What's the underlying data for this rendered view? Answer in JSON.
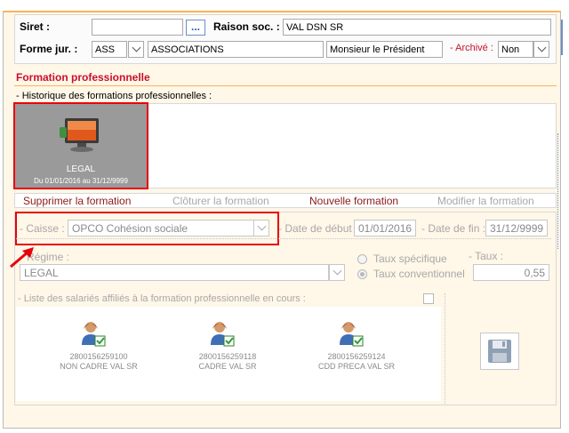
{
  "header": {
    "siret_label": "Siret :",
    "siret_value": "",
    "ellipsis_label": "...",
    "raison_label": "Raison soc. :",
    "raison_value": "VAL DSN SR",
    "forme_label": "Forme jur. :",
    "forme_code": "ASS",
    "forme_value": "ASSOCIATIONS",
    "title_value": "Monsieur le Président",
    "archive_label": "- Archivé :",
    "archive_value": "Non"
  },
  "section": {
    "title": "Formation professionnelle",
    "history_label": "- Historique des formations professionnelles :"
  },
  "tile": {
    "name": "LEGAL",
    "dates": "Du 01/01/2016 au 31/12/9999"
  },
  "actions": {
    "delete": "Supprimer la formation",
    "close": "Clôturer la formation",
    "new": "Nouvelle formation",
    "modify": "Modifier la formation"
  },
  "detail": {
    "caisse_label": "- Caisse :",
    "caisse_value": "OPCO Cohésion sociale",
    "date_debut_label": "- Date de début :",
    "date_debut_value": "01/01/2016",
    "date_fin_label": "- Date de fin :",
    "date_fin_value": "31/12/9999",
    "regime_label": "Régime :",
    "regime_value": "LEGAL",
    "taux_specifique": "Taux spécifique",
    "taux_conventionnel": "Taux conventionnel",
    "taux_label": "- Taux :",
    "taux_value": "0,55"
  },
  "employees": {
    "label": "- Liste des salariés affiliés à la formation professionnelle en cours :",
    "items": [
      {
        "id": "2800156259100",
        "name": "NON CADRE VAL SR"
      },
      {
        "id": "2800156259118",
        "name": "CADRE VAL SR"
      },
      {
        "id": "2800156259124",
        "name": "CDD PRECA VAL SR"
      }
    ]
  },
  "colors": {
    "accent_red": "#c8102e",
    "highlight_red": "#e8000b",
    "orange_line": "#fbb45c",
    "panel_bg": "#fff7e8"
  }
}
